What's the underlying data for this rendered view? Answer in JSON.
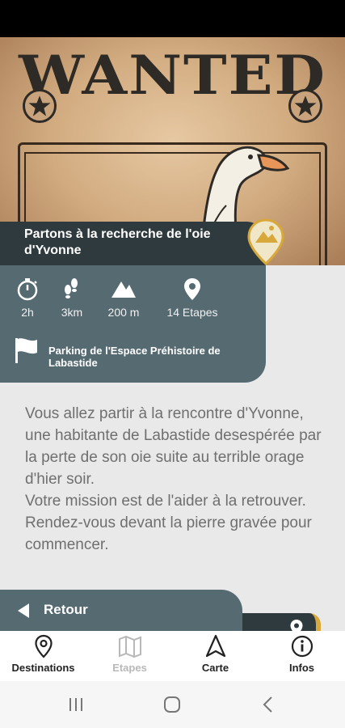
{
  "hero": {
    "poster_text": "WANTED"
  },
  "title_card": {
    "title": "Partons à la recherche de l'oie d'Yvonne"
  },
  "info_card": {
    "stats": [
      {
        "icon": "stopwatch-icon",
        "value": "2h"
      },
      {
        "icon": "footsteps-icon",
        "value": "3km"
      },
      {
        "icon": "mountain-icon",
        "value": "200 m"
      },
      {
        "icon": "map-pin-icon",
        "value": "14 Etapes"
      }
    ],
    "start_location": "Parking de l'Espace Préhistoire de Labastide"
  },
  "description": "Vous allez partir à la rencontre d'Yvonne, une habitante de Labastide desespérée par la perte de son oie suite au terrible orage d'hier soir.\nVotre mission est de l'aider à la retrouver.\nRendez-vous devant la pierre gravée pour commencer.",
  "footer_actions": {
    "back_label": "Retour"
  },
  "bottom_nav": {
    "items": [
      {
        "label": "Destinations",
        "icon": "map-pin-outline-icon",
        "enabled": true
      },
      {
        "label": "Etapes",
        "icon": "folded-map-icon",
        "enabled": false
      },
      {
        "label": "Carte",
        "icon": "navigation-arrow-icon",
        "enabled": true
      },
      {
        "label": "Infos",
        "icon": "info-circle-icon",
        "enabled": true
      }
    ]
  },
  "colors": {
    "title_card": "#2f3a3e",
    "info_card": "#566a72",
    "accent": "#d9a83a",
    "description_text": "#6f6f6f"
  }
}
